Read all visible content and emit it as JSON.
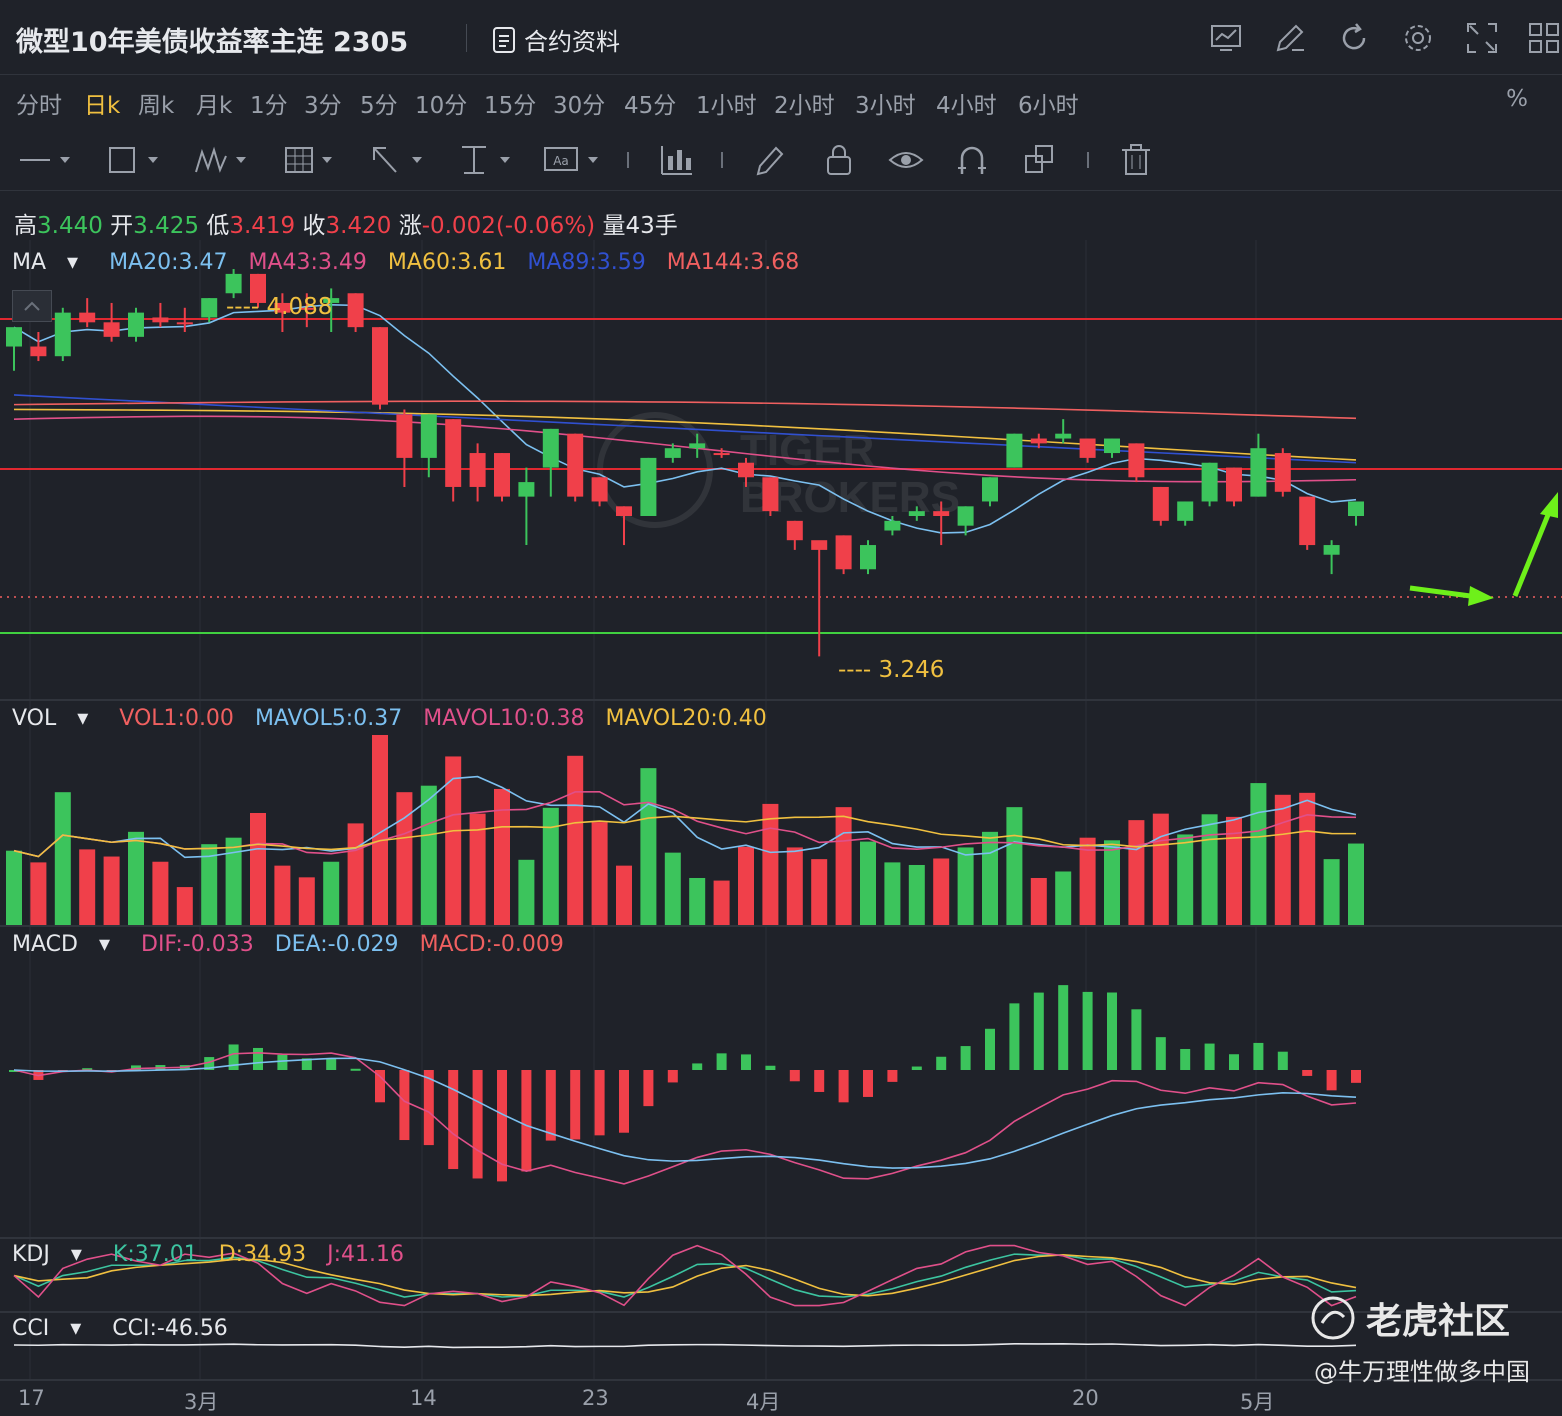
{
  "title": "微型10年美债收益率主连 2305",
  "contract_button": "合约资料",
  "toolbar_icons": [
    "chart-icon",
    "edit-icon",
    "refresh-icon",
    "gear-icon",
    "fullscreen-icon",
    "grid-icon"
  ],
  "periods": [
    "分时",
    "日k",
    "周k",
    "月k",
    "1分",
    "3分",
    "5分",
    "10分",
    "15分",
    "30分",
    "45分",
    "1小时",
    "2小时",
    "3小时",
    "4小时",
    "6小时"
  ],
  "active_period": "日k",
  "percent_toggle": "%",
  "draw_tools": [
    "line-tool-icon",
    "rect-tool-icon",
    "wave-tool-icon",
    "grid-tool-icon",
    "arrow-tool-icon",
    "measure-tool-icon",
    "text-tool-icon",
    "bar-tool-icon",
    "pen-tool-icon",
    "lock-icon",
    "eye-icon",
    "magnet-icon",
    "layers-icon",
    "trash-icon"
  ],
  "ohlc": {
    "high_label": "高",
    "high": "3.440",
    "open_label": "开",
    "open": "3.425",
    "low_label": "低",
    "low": "3.419",
    "close_label": "收",
    "close": "3.420",
    "change_label": "涨",
    "change": "-0.002(-0.06%)",
    "volume_label": "量",
    "volume": "43手"
  },
  "ma_panel": {
    "name": "MA",
    "ma20": "MA20:3.47",
    "ma43": "MA43:3.49",
    "ma60": "MA60:3.61",
    "ma89": "MA89:3.59",
    "ma144": "MA144:3.68",
    "high_marker": "---- 4.088",
    "low_marker": "---- 3.246"
  },
  "vol_panel": {
    "name": "VOL",
    "vol1": "VOL1:0.00",
    "mavol5": "MAVOL5:0.37",
    "mavol10": "MAVOL10:0.38",
    "mavol20": "MAVOL20:0.40"
  },
  "macd_panel": {
    "name": "MACD",
    "dif": "DIF:-0.033",
    "dea": "DEA:-0.029",
    "macd": "MACD:-0.009"
  },
  "kdj_panel": {
    "name": "KDJ",
    "k": "K:37.01",
    "d": "D:34.93",
    "j": "J:41.16"
  },
  "cci_panel": {
    "name": "CCI",
    "cci": "CCI:-46.56"
  },
  "dates": [
    "17",
    "3月",
    "14",
    "23",
    "4月",
    "20",
    "5月"
  ],
  "watermark": "老虎社区",
  "user_handle": "@牛万理性做多中国",
  "colors": {
    "up": "#f0404a",
    "down": "#3cc45c",
    "ma20": "#7cc0f0",
    "ma43": "#e0508a",
    "ma60": "#f0c040",
    "ma89": "#3050d0",
    "ma144": "#f06060",
    "accent": "#f0c040"
  },
  "chart_data": {
    "type": "candlestick",
    "y_range": [
      3.2,
      4.15
    ],
    "candles": [
      {
        "o": 3.93,
        "h": 3.96,
        "l": 3.88,
        "c": 3.97
      },
      {
        "o": 3.93,
        "h": 3.96,
        "l": 3.9,
        "c": 3.91
      },
      {
        "o": 3.91,
        "h": 4.01,
        "l": 3.9,
        "c": 4.0
      },
      {
        "o": 4.0,
        "h": 4.03,
        "l": 3.97,
        "c": 3.98
      },
      {
        "o": 3.98,
        "h": 4.02,
        "l": 3.94,
        "c": 3.95
      },
      {
        "o": 3.95,
        "h": 4.01,
        "l": 3.94,
        "c": 4.0
      },
      {
        "o": 3.99,
        "h": 4.02,
        "l": 3.97,
        "c": 3.98
      },
      {
        "o": 3.98,
        "h": 4.01,
        "l": 3.96,
        "c": 3.98
      },
      {
        "o": 3.99,
        "h": 4.03,
        "l": 3.98,
        "c": 4.03
      },
      {
        "o": 4.04,
        "h": 4.09,
        "l": 4.03,
        "c": 4.08
      },
      {
        "o": 4.08,
        "h": 4.08,
        "l": 4.01,
        "c": 4.02
      },
      {
        "o": 4.02,
        "h": 4.04,
        "l": 3.96,
        "c": 4.0
      },
      {
        "o": 4.01,
        "h": 4.04,
        "l": 3.97,
        "c": 4.01
      },
      {
        "o": 4.02,
        "h": 4.05,
        "l": 3.96,
        "c": 4.03
      },
      {
        "o": 4.04,
        "h": 4.04,
        "l": 3.96,
        "c": 3.97
      },
      {
        "o": 3.97,
        "h": 3.97,
        "l": 3.8,
        "c": 3.81
      },
      {
        "o": 3.79,
        "h": 3.8,
        "l": 3.64,
        "c": 3.7
      },
      {
        "o": 3.7,
        "h": 3.79,
        "l": 3.66,
        "c": 3.79
      },
      {
        "o": 3.78,
        "h": 3.78,
        "l": 3.61,
        "c": 3.64
      },
      {
        "o": 3.71,
        "h": 3.73,
        "l": 3.61,
        "c": 3.64
      },
      {
        "o": 3.71,
        "h": 3.71,
        "l": 3.61,
        "c": 3.62
      },
      {
        "o": 3.62,
        "h": 3.68,
        "l": 3.52,
        "c": 3.65
      },
      {
        "o": 3.68,
        "h": 3.76,
        "l": 3.62,
        "c": 3.76
      },
      {
        "o": 3.75,
        "h": 3.75,
        "l": 3.61,
        "c": 3.62
      },
      {
        "o": 3.66,
        "h": 3.66,
        "l": 3.6,
        "c": 3.61
      },
      {
        "o": 3.6,
        "h": 3.6,
        "l": 3.52,
        "c": 3.58
      },
      {
        "o": 3.58,
        "h": 3.7,
        "l": 3.58,
        "c": 3.7
      },
      {
        "o": 3.7,
        "h": 3.73,
        "l": 3.69,
        "c": 3.72
      },
      {
        "o": 3.72,
        "h": 3.75,
        "l": 3.7,
        "c": 3.73
      },
      {
        "o": 3.71,
        "h": 3.72,
        "l": 3.7,
        "c": 3.71
      },
      {
        "o": 3.69,
        "h": 3.7,
        "l": 3.64,
        "c": 3.66
      },
      {
        "o": 3.66,
        "h": 3.66,
        "l": 3.58,
        "c": 3.59
      },
      {
        "o": 3.57,
        "h": 3.57,
        "l": 3.51,
        "c": 3.53
      },
      {
        "o": 3.53,
        "h": 3.52,
        "l": 3.29,
        "c": 3.51
      },
      {
        "o": 3.54,
        "h": 3.54,
        "l": 3.46,
        "c": 3.47
      },
      {
        "o": 3.47,
        "h": 3.53,
        "l": 3.46,
        "c": 3.52
      },
      {
        "o": 3.55,
        "h": 3.58,
        "l": 3.54,
        "c": 3.57
      },
      {
        "o": 3.58,
        "h": 3.6,
        "l": 3.57,
        "c": 3.59
      },
      {
        "o": 3.59,
        "h": 3.61,
        "l": 3.52,
        "c": 3.58
      },
      {
        "o": 3.56,
        "h": 3.6,
        "l": 3.54,
        "c": 3.6
      },
      {
        "o": 3.61,
        "h": 3.66,
        "l": 3.6,
        "c": 3.66
      },
      {
        "o": 3.68,
        "h": 3.75,
        "l": 3.68,
        "c": 3.75
      },
      {
        "o": 3.74,
        "h": 3.75,
        "l": 3.72,
        "c": 3.73
      },
      {
        "o": 3.74,
        "h": 3.78,
        "l": 3.73,
        "c": 3.75
      },
      {
        "o": 3.74,
        "h": 3.74,
        "l": 3.69,
        "c": 3.7
      },
      {
        "o": 3.71,
        "h": 3.74,
        "l": 3.7,
        "c": 3.74
      },
      {
        "o": 3.73,
        "h": 3.73,
        "l": 3.65,
        "c": 3.66
      },
      {
        "o": 3.64,
        "h": 3.64,
        "l": 3.56,
        "c": 3.57
      },
      {
        "o": 3.57,
        "h": 3.61,
        "l": 3.56,
        "c": 3.61
      },
      {
        "o": 3.61,
        "h": 3.69,
        "l": 3.6,
        "c": 3.69
      },
      {
        "o": 3.68,
        "h": 3.68,
        "l": 3.6,
        "c": 3.61
      },
      {
        "o": 3.62,
        "h": 3.75,
        "l": 3.62,
        "c": 3.72
      },
      {
        "o": 3.71,
        "h": 3.72,
        "l": 3.62,
        "c": 3.63
      },
      {
        "o": 3.62,
        "h": 3.62,
        "l": 3.51,
        "c": 3.52
      },
      {
        "o": 3.5,
        "h": 3.53,
        "l": 3.46,
        "c": 3.52
      },
      {
        "o": 3.58,
        "h": 3.59,
        "l": 3.56,
        "c": 3.61
      }
    ]
  }
}
